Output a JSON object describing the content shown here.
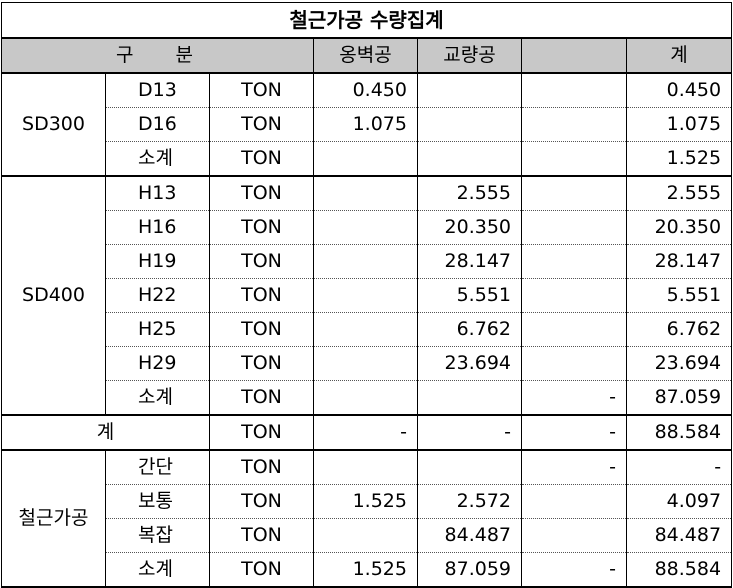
{
  "title": "철근가공 수량집계",
  "header": {
    "gubun": "구   분",
    "col_a": "옹벽공",
    "col_b": "교량공",
    "col_c": "",
    "total": "계"
  },
  "groups": {
    "sd300": "SD300",
    "sd400": "SD400",
    "gye": "계",
    "gagong": "철근가공"
  },
  "rows": [
    {
      "item": "D13",
      "unit": "TON",
      "a": "0.450",
      "b": "",
      "c": "",
      "total": "0.450"
    },
    {
      "item": "D16",
      "unit": "TON",
      "a": "1.075",
      "b": "",
      "c": "",
      "total": "1.075"
    },
    {
      "item": "소계",
      "unit": "TON",
      "a": "",
      "b": "",
      "c": "",
      "total": "1.525"
    },
    {
      "item": "H13",
      "unit": "TON",
      "a": "",
      "b": "2.555",
      "c": "",
      "total": "2.555"
    },
    {
      "item": "H16",
      "unit": "TON",
      "a": "",
      "b": "20.350",
      "c": "",
      "total": "20.350"
    },
    {
      "item": "H19",
      "unit": "TON",
      "a": "",
      "b": "28.147",
      "c": "",
      "total": "28.147"
    },
    {
      "item": "H22",
      "unit": "TON",
      "a": "",
      "b": "5.551",
      "c": "",
      "total": "5.551"
    },
    {
      "item": "H25",
      "unit": "TON",
      "a": "",
      "b": "6.762",
      "c": "",
      "total": "6.762"
    },
    {
      "item": "H29",
      "unit": "TON",
      "a": "",
      "b": "23.694",
      "c": "",
      "total": "23.694"
    },
    {
      "item": "소계",
      "unit": "TON",
      "a": "",
      "b": "",
      "c": "-",
      "total": "87.059"
    },
    {
      "item": "",
      "unit": "TON",
      "a": "-",
      "b": "-",
      "c": "-",
      "total": "88.584"
    },
    {
      "item": "간단",
      "unit": "TON",
      "a": "",
      "b": "",
      "c": "-",
      "total": "-"
    },
    {
      "item": "보통",
      "unit": "TON",
      "a": "1.525",
      "b": "2.572",
      "c": "",
      "total": "4.097"
    },
    {
      "item": "복잡",
      "unit": "TON",
      "a": "",
      "b": "84.487",
      "c": "",
      "total": "84.487"
    },
    {
      "item": "소계",
      "unit": "TON",
      "a": "1.525",
      "b": "87.059",
      "c": "-",
      "total": "88.584"
    }
  ]
}
